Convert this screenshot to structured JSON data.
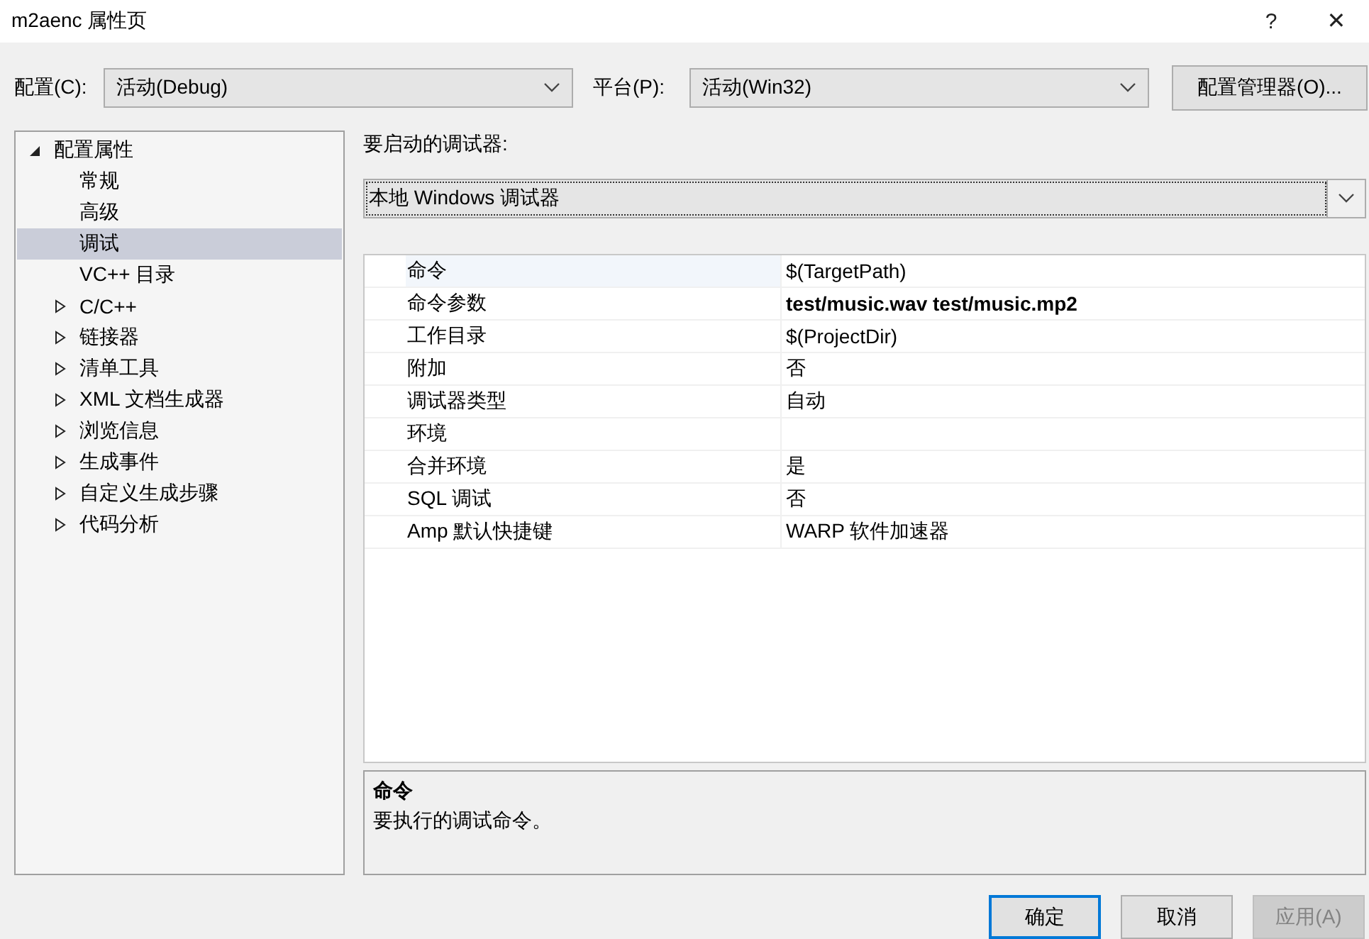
{
  "window": {
    "title": "m2aenc 属性页",
    "help": "?",
    "close": "✕"
  },
  "toolbar": {
    "config_label": "配置(C):",
    "config_value": "活动(Debug)",
    "platform_label": "平台(P):",
    "platform_value": "活动(Win32)",
    "manager_button": "配置管理器(O)..."
  },
  "tree": [
    {
      "label": "配置属性",
      "kind": "group",
      "expanded": true,
      "selected": false,
      "children": [
        {
          "label": "常规",
          "kind": "leaf",
          "selected": false
        },
        {
          "label": "高级",
          "kind": "leaf",
          "selected": false
        },
        {
          "label": "调试",
          "kind": "leaf",
          "selected": true
        },
        {
          "label": "VC++ 目录",
          "kind": "leaf",
          "selected": false
        },
        {
          "label": "C/C++",
          "kind": "group",
          "expanded": false,
          "selected": false
        },
        {
          "label": "链接器",
          "kind": "group",
          "expanded": false,
          "selected": false
        },
        {
          "label": "清单工具",
          "kind": "group",
          "expanded": false,
          "selected": false
        },
        {
          "label": "XML 文档生成器",
          "kind": "group",
          "expanded": false,
          "selected": false
        },
        {
          "label": "浏览信息",
          "kind": "group",
          "expanded": false,
          "selected": false
        },
        {
          "label": "生成事件",
          "kind": "group",
          "expanded": false,
          "selected": false
        },
        {
          "label": "自定义生成步骤",
          "kind": "group",
          "expanded": false,
          "selected": false
        },
        {
          "label": "代码分析",
          "kind": "group",
          "expanded": false,
          "selected": false
        }
      ]
    }
  ],
  "debugger": {
    "label": "要启动的调试器:",
    "value": "本地 Windows 调试器"
  },
  "properties": [
    {
      "name": "命令",
      "value": "$(TargetPath)",
      "modified": false,
      "selected": true
    },
    {
      "name": "命令参数",
      "value": "test/music.wav test/music.mp2",
      "modified": true,
      "selected": false
    },
    {
      "name": "工作目录",
      "value": "$(ProjectDir)",
      "modified": false,
      "selected": false
    },
    {
      "name": "附加",
      "value": "否",
      "modified": false,
      "selected": false
    },
    {
      "name": "调试器类型",
      "value": "自动",
      "modified": false,
      "selected": false
    },
    {
      "name": "环境",
      "selected": false
    },
    {
      "name": "合并环境",
      "value": "是",
      "modified": false,
      "selected": false
    },
    {
      "name": "SQL 调试",
      "value": "否",
      "modified": false,
      "selected": false
    },
    {
      "name": "Amp 默认快捷键",
      "value": "WARP 软件加速器",
      "modified": false,
      "selected": false
    }
  ],
  "description": {
    "title": "命令",
    "text": "要执行的调试命令。"
  },
  "buttons": [
    {
      "label": "确定",
      "default": true,
      "disabled": false
    },
    {
      "label": "取消",
      "default": false,
      "disabled": false
    },
    {
      "label": "应用(A)",
      "default": false,
      "disabled": true
    }
  ]
}
